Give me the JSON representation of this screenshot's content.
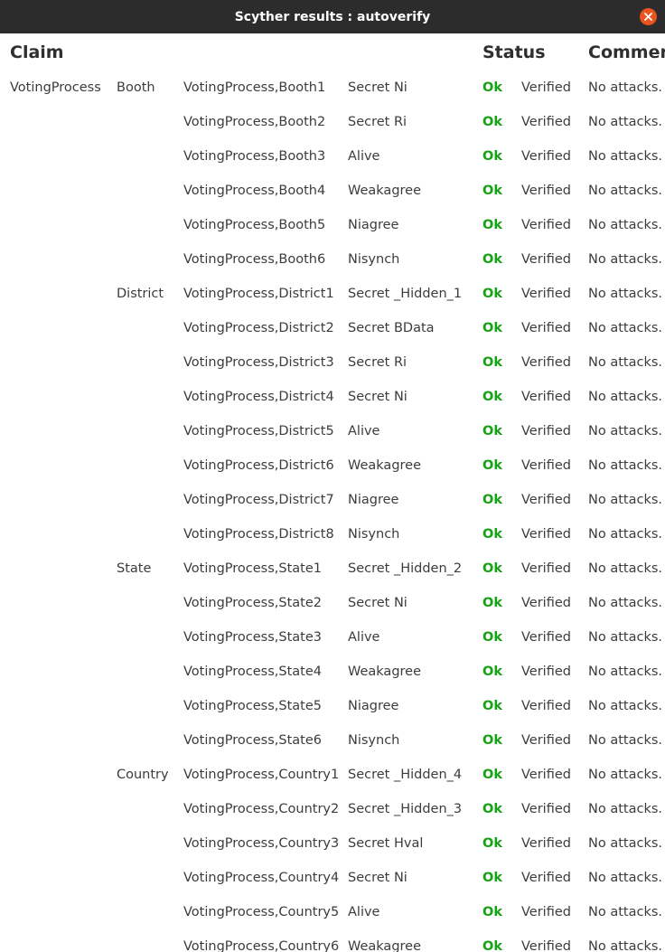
{
  "window": {
    "title": "Scyther results : autoverify"
  },
  "header": {
    "claim": "Claim",
    "status": "Status",
    "comments": "Commer"
  },
  "rows": [
    {
      "protocol": "VotingProcess",
      "role": "Booth",
      "id": "VotingProcess,Booth1",
      "claim": "Secret Ni",
      "status": "Ok",
      "verified": "Verified",
      "comment": "No attacks."
    },
    {
      "protocol": "",
      "role": "",
      "id": "VotingProcess,Booth2",
      "claim": "Secret Ri",
      "status": "Ok",
      "verified": "Verified",
      "comment": "No attacks."
    },
    {
      "protocol": "",
      "role": "",
      "id": "VotingProcess,Booth3",
      "claim": "Alive",
      "status": "Ok",
      "verified": "Verified",
      "comment": "No attacks."
    },
    {
      "protocol": "",
      "role": "",
      "id": "VotingProcess,Booth4",
      "claim": "Weakagree",
      "status": "Ok",
      "verified": "Verified",
      "comment": "No attacks."
    },
    {
      "protocol": "",
      "role": "",
      "id": "VotingProcess,Booth5",
      "claim": "Niagree",
      "status": "Ok",
      "verified": "Verified",
      "comment": "No attacks."
    },
    {
      "protocol": "",
      "role": "",
      "id": "VotingProcess,Booth6",
      "claim": "Nisynch",
      "status": "Ok",
      "verified": "Verified",
      "comment": "No attacks."
    },
    {
      "protocol": "",
      "role": "District",
      "id": "VotingProcess,District1",
      "claim": "Secret _Hidden_1",
      "status": "Ok",
      "verified": "Verified",
      "comment": "No attacks."
    },
    {
      "protocol": "",
      "role": "",
      "id": "VotingProcess,District2",
      "claim": "Secret BData",
      "status": "Ok",
      "verified": "Verified",
      "comment": "No attacks."
    },
    {
      "protocol": "",
      "role": "",
      "id": "VotingProcess,District3",
      "claim": "Secret Ri",
      "status": "Ok",
      "verified": "Verified",
      "comment": "No attacks."
    },
    {
      "protocol": "",
      "role": "",
      "id": "VotingProcess,District4",
      "claim": "Secret Ni",
      "status": "Ok",
      "verified": "Verified",
      "comment": "No attacks."
    },
    {
      "protocol": "",
      "role": "",
      "id": "VotingProcess,District5",
      "claim": "Alive",
      "status": "Ok",
      "verified": "Verified",
      "comment": "No attacks."
    },
    {
      "protocol": "",
      "role": "",
      "id": "VotingProcess,District6",
      "claim": "Weakagree",
      "status": "Ok",
      "verified": "Verified",
      "comment": "No attacks."
    },
    {
      "protocol": "",
      "role": "",
      "id": "VotingProcess,District7",
      "claim": "Niagree",
      "status": "Ok",
      "verified": "Verified",
      "comment": "No attacks."
    },
    {
      "protocol": "",
      "role": "",
      "id": "VotingProcess,District8",
      "claim": "Nisynch",
      "status": "Ok",
      "verified": "Verified",
      "comment": "No attacks."
    },
    {
      "protocol": "",
      "role": "State",
      "id": "VotingProcess,State1",
      "claim": "Secret _Hidden_2",
      "status": "Ok",
      "verified": "Verified",
      "comment": "No attacks."
    },
    {
      "protocol": "",
      "role": "",
      "id": "VotingProcess,State2",
      "claim": "Secret Ni",
      "status": "Ok",
      "verified": "Verified",
      "comment": "No attacks."
    },
    {
      "protocol": "",
      "role": "",
      "id": "VotingProcess,State3",
      "claim": "Alive",
      "status": "Ok",
      "verified": "Verified",
      "comment": "No attacks."
    },
    {
      "protocol": "",
      "role": "",
      "id": "VotingProcess,State4",
      "claim": "Weakagree",
      "status": "Ok",
      "verified": "Verified",
      "comment": "No attacks."
    },
    {
      "protocol": "",
      "role": "",
      "id": "VotingProcess,State5",
      "claim": "Niagree",
      "status": "Ok",
      "verified": "Verified",
      "comment": "No attacks."
    },
    {
      "protocol": "",
      "role": "",
      "id": "VotingProcess,State6",
      "claim": "Nisynch",
      "status": "Ok",
      "verified": "Verified",
      "comment": "No attacks."
    },
    {
      "protocol": "",
      "role": "Country",
      "id": "VotingProcess,Country1",
      "claim": "Secret _Hidden_4",
      "status": "Ok",
      "verified": "Verified",
      "comment": "No attacks."
    },
    {
      "protocol": "",
      "role": "",
      "id": "VotingProcess,Country2",
      "claim": "Secret _Hidden_3",
      "status": "Ok",
      "verified": "Verified",
      "comment": "No attacks."
    },
    {
      "protocol": "",
      "role": "",
      "id": "VotingProcess,Country3",
      "claim": "Secret Hval",
      "status": "Ok",
      "verified": "Verified",
      "comment": "No attacks."
    },
    {
      "protocol": "",
      "role": "",
      "id": "VotingProcess,Country4",
      "claim": "Secret Ni",
      "status": "Ok",
      "verified": "Verified",
      "comment": "No attacks."
    },
    {
      "protocol": "",
      "role": "",
      "id": "VotingProcess,Country5",
      "claim": "Alive",
      "status": "Ok",
      "verified": "Verified",
      "comment": "No attacks."
    },
    {
      "protocol": "",
      "role": "",
      "id": "VotingProcess,Country6",
      "claim": "Weakagree",
      "status": "Ok",
      "verified": "Verified",
      "comment": "No attacks."
    }
  ]
}
